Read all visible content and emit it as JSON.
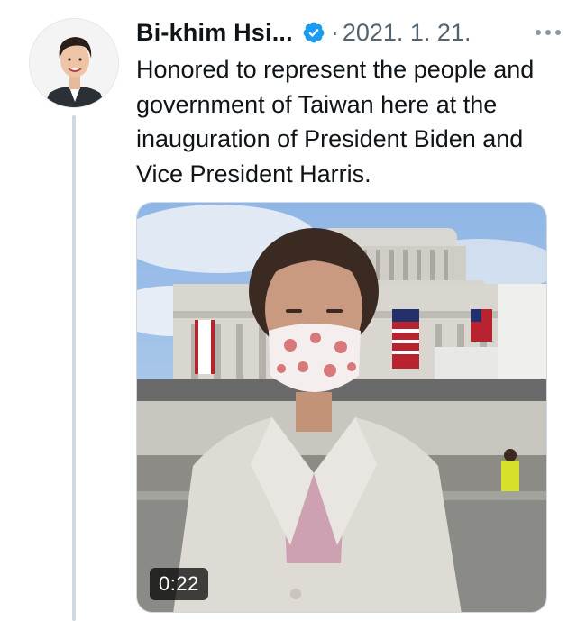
{
  "tweet": {
    "author_name": "Bi-khim Hsi...",
    "verified": true,
    "separator": "·",
    "date": "2021. 1. 21.",
    "text": "Honored to represent the people and government of Taiwan here at the inauguration of President Biden and Vice President Harris.",
    "video_duration": "0:22"
  },
  "icons": {
    "verified": "verified-badge-icon",
    "more": "more-horizontal-icon"
  },
  "colors": {
    "verified_blue": "#1d9bf0",
    "secondary_text": "#536471",
    "thread_line": "#cfd9de"
  }
}
